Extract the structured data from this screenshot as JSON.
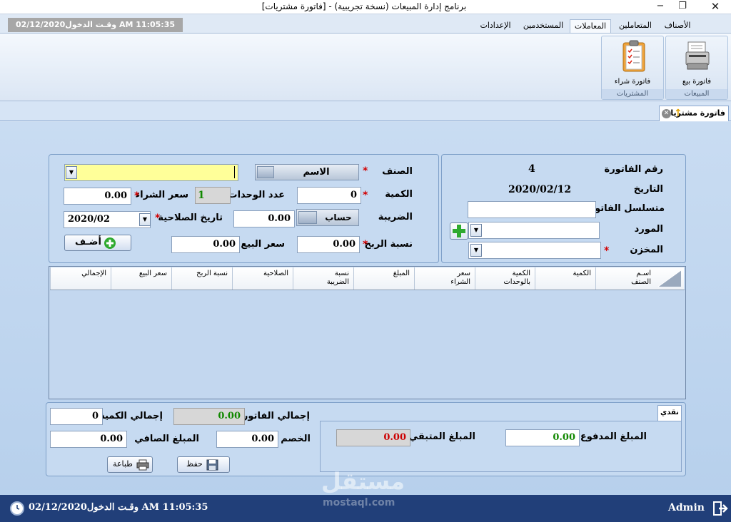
{
  "window": {
    "title": "برنامج إدارة المبيعات (نسخة تجريبية) - [فاتورة مشتريات]"
  },
  "ribbon": {
    "tabs": [
      "الأصناف",
      "المتعاملين",
      "المعاملات",
      "المستخدمين",
      "الإعدادات"
    ],
    "active_tab": "المعاملات",
    "login_text": "وقـت الدخول02/12/2020 AM 11:05:35",
    "groups": [
      {
        "label": "المبيعات",
        "button": "فاتورة بيع"
      },
      {
        "label": "المشتريات",
        "button": "فاتورة شراء"
      }
    ]
  },
  "document_tab": "فاتورة مشتريات",
  "invoice_info": {
    "number_label": "رقم الفاتورة",
    "number_value": "4",
    "date_label": "التاريخ",
    "date_value": "2020/02/12",
    "serial_label": "متسلسل الفاتورة",
    "serial_value": "",
    "supplier_label": "المورد",
    "supplier_value": "",
    "store_label": "المخزن",
    "store_value": ""
  },
  "item_form": {
    "item_label": "الصنف",
    "item_value": "",
    "name_toggle": "الاسم",
    "qty_label": "الكمية",
    "qty_value": "0",
    "units_label": "عدد الوحدات",
    "units_value": "1",
    "buy_price_label": "سعر الشراء",
    "buy_price_value": "0.00",
    "tax_label": "الضريبة",
    "tax_toggle": "حساب",
    "tax_value": "0.00",
    "expiry_label": "تاريخ الصلاحية",
    "expiry_value": "2020/02",
    "profit_label": "نسبة الربح",
    "profit_value": "0.00",
    "sell_price_label": "سعر البيع",
    "sell_price_value": "0.00",
    "add_button": "أضـف"
  },
  "grid": {
    "columns": [
      "اسـم\nالصنف",
      "الكمية",
      "الكمية\nبالوحدات",
      "سعر\nالشراء",
      "المبلغ",
      "نسبة\nالضريبة",
      "الصلاحية",
      "نسبة الربح",
      "سعر البيع",
      "الإجمالي"
    ]
  },
  "payment": {
    "tab_label": "نقدي",
    "paid_label": "المبلغ المدفوع",
    "paid_value": "0.00",
    "remaining_label": "المبلغ المتبقي",
    "remaining_value": "0.00"
  },
  "totals": {
    "invoice_total_label": "إجمالي الفاتورة",
    "invoice_total_value": "0.00",
    "qty_total_label": "إجمالي الكمية",
    "qty_total_value": "0",
    "discount_label": "الخصم",
    "discount_value": "0.00",
    "net_label": "المبلغ الصافي",
    "net_value": "0.00",
    "save_button": "حفظ",
    "print_button": "طباعة"
  },
  "statusbar": {
    "user": "Admin",
    "login_text": "وقـت الدخول02/12/2020 AM 11:05:35",
    "watermark_ar": "مستقل",
    "watermark_en": "mostaql.com"
  },
  "colors": {
    "required_star": "#d20000",
    "yellow_input": "#ffff99",
    "green_value": "#118800",
    "red_value": "#cc0000",
    "statusbar": "#213f79"
  }
}
